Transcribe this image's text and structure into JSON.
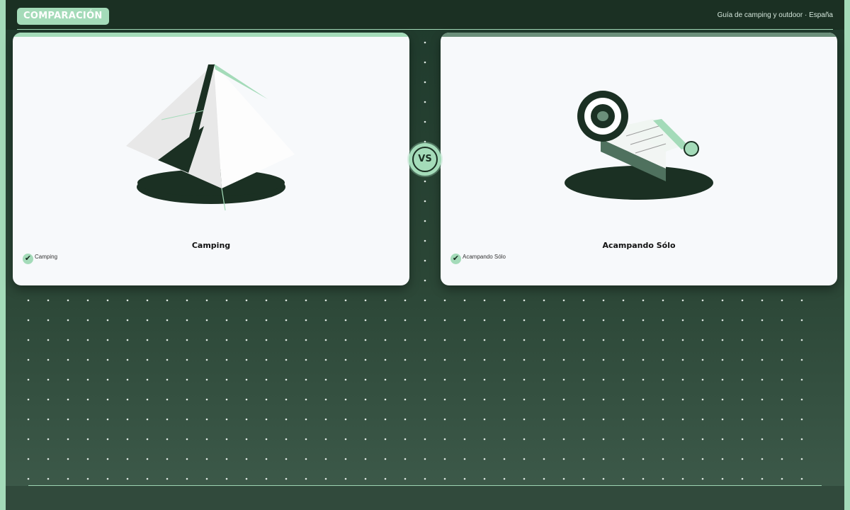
{
  "header": {
    "badge": "COMPARACIÓN",
    "subtitle": "Guía de camping y outdoor · España"
  },
  "vs_label": "VS",
  "cards": [
    {
      "title": "Camping",
      "check_label": "Camping",
      "icon": "tent-icon"
    },
    {
      "title": "Acampando Sólo",
      "check_label": "Acampando Sólo",
      "icon": "sleeping-bag-icon"
    }
  ],
  "colors": {
    "accent": "#a4dbb9",
    "dark": "#1b3023",
    "background_top": "#1f3a2c",
    "background_bottom": "#3e5b4b",
    "card": "#f7f9fb"
  }
}
